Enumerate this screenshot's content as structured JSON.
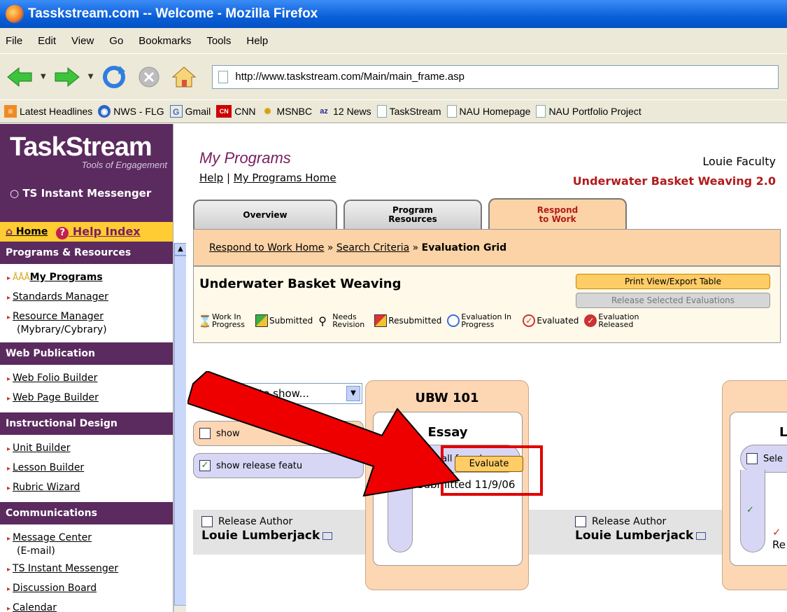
{
  "browser": {
    "window_title": "Tasskstream.com -- Welcome - Mozilla Firefox",
    "menu": [
      "File",
      "Edit",
      "View",
      "Go",
      "Bookmarks",
      "Tools",
      "Help"
    ],
    "url": "http://www.taskstream.com/Main/main_frame.asp",
    "bookmarks": [
      "Latest Headlines",
      "NWS - FLG",
      "Gmail",
      "CNN",
      "MSNBC",
      "12 News",
      "TaskStream",
      "NAU Homepage",
      "NAU Portfolio Project"
    ]
  },
  "sidebar": {
    "logo": "TaskStream",
    "tagline": "Tools of Engagement",
    "instant_messenger": "TS Instant Messenger",
    "quick_home": "Home",
    "quick_help": "Help Index",
    "programs_header": "Programs & Resources",
    "programs_items": [
      "My Programs",
      "Standards Manager",
      "Resource Manager"
    ],
    "resource_sub": "(Mybrary/Cybrary)",
    "web_header": "Web Publication",
    "web_items": [
      "Web Folio Builder",
      "Web Page Builder"
    ],
    "design_header": "Instructional Design",
    "design_items": [
      "Unit Builder",
      "Lesson Builder",
      "Rubric Wizard"
    ],
    "comm_header": "Communications",
    "comm_items": [
      "Message Center",
      "TS Instant Messenger",
      "Discussion Board",
      "Calendar"
    ],
    "message_sub": "(E-mail)"
  },
  "main": {
    "title": "My Programs",
    "user": "Louie Faculty",
    "help": "Help",
    "home": "My Programs Home",
    "program": "Underwater Basket Weaving 2.0",
    "tabs": [
      "Overview",
      "Program Resources",
      "Respond to Work"
    ],
    "crumbs": [
      "Respond to Work Home",
      "Search Criteria",
      "Evaluation Grid"
    ],
    "grid_title": "Underwater Basket Weaving",
    "print_btn": "Print View/Export Table",
    "release_btn": "Release Selected Evaluations",
    "legend": [
      "Work In Progress",
      "Submitted",
      "Needs Revision",
      "Resubmitted",
      "Evaluation In Progress",
      "Evaluated",
      "Evaluation Released"
    ],
    "show_select": "hat to show...",
    "show_option1": "show",
    "show_option2": "show release featu",
    "release_author": "Release Author",
    "author_name": "Louie Lumberjack",
    "course": "UBW 101",
    "assignment": "Essay",
    "select_all": "Select all for release",
    "evaluate": "Evaluate",
    "submitted": "Submitted 11/9/06",
    "course2_letter": "L",
    "course2_select": "Sele",
    "course2_re": "Re"
  }
}
